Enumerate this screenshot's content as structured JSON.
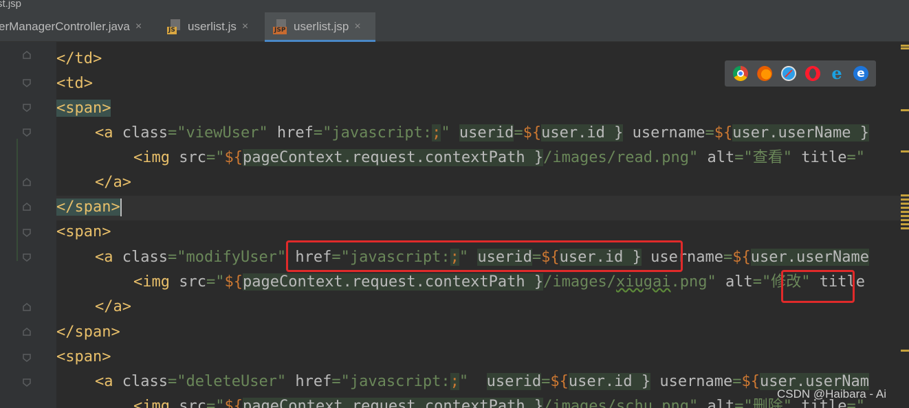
{
  "window": {
    "title_fragment": "st.jsp"
  },
  "tabs": [
    {
      "label": "erManagerController.java",
      "icon": "java-file-icon",
      "active": false
    },
    {
      "label": "userlist.js",
      "icon": "js-file-icon",
      "badge": "JS",
      "active": false
    },
    {
      "label": "userlist.jsp",
      "icon": "jsp-file-icon",
      "badge": "JSP",
      "active": true
    }
  ],
  "tab_close_glyph": "×",
  "code": {
    "l1": {
      "t1": "</td>"
    },
    "l2": {
      "t1": "<td>"
    },
    "l3": {
      "t1": "<",
      "t2": "span",
      "t3": ">"
    },
    "l4": {
      "t1": "<a ",
      "a1": "class",
      "e1": "=",
      "s1": "\"viewUser\"",
      "a2": " href",
      "e2": "=",
      "s2": "\"javascript:",
      "semi": ";",
      "s3": "\"",
      "sp": " ",
      "a3": "userid",
      "e3": "=",
      "v1": "${",
      "v2": "user.id }",
      "sp2": " ",
      "a4": "username",
      "e4": "=",
      "v3": "${",
      "v4": "user.userName }"
    },
    "l5": {
      "t1": "<img ",
      "a1": "src",
      "e1": "=",
      "s1": "\"",
      "v1": "${",
      "v2": "pageContext.request.contextPath }",
      "s2": "/images/read.png\"",
      "a2": " alt",
      "e2": "=",
      "s3": "\"查看\"",
      "a3": " title",
      "e3": "=",
      "s4": "\""
    },
    "l6": {
      "t1": "</a>"
    },
    "l7": {
      "t1": "</",
      "t2": "span",
      "t3": ">"
    },
    "l8": {
      "t1": "<span>"
    },
    "l9": {
      "t1": "<a ",
      "a1": "class",
      "e1": "=",
      "s1": "\"modifyUser\"",
      "a2": " href",
      "e2": "=",
      "s2": "\"javascript:",
      "semi": ";",
      "s3": "\"",
      "sp": " ",
      "a3": "userid",
      "e3": "=",
      "v1": "${",
      "v2": "user.id }",
      "sp2": " ",
      "a4": "username",
      "e4": "=",
      "v3": "${",
      "v4": "user.userName"
    },
    "l10": {
      "t1": "<img ",
      "a1": "src",
      "e1": "=",
      "s1": "\"",
      "v1": "${",
      "v2": "pageContext.request.contextPath }",
      "s2": "/images/",
      "s2b": "xiugai",
      "s2c": ".png\"",
      "a2": " alt",
      "e2": "=",
      "s3": "\"修改\"",
      "a3": " title"
    },
    "l11": {
      "t1": "</a>"
    },
    "l12": {
      "t1": "</span>"
    },
    "l13": {
      "t1": "<span>"
    },
    "l14": {
      "t1": "<a ",
      "a1": "class",
      "e1": "=",
      "s1": "\"deleteUser\"",
      "a2": " href",
      "e2": "=",
      "s2": "\"javascript:",
      "semi": ";",
      "s3": "\"",
      "sp": "  ",
      "a3": "userid",
      "e3": "=",
      "v1": "${",
      "v2": "user.id }",
      "sp2": " ",
      "a4": "username",
      "e4": "=",
      "v3": "${",
      "v4": "user.userNam"
    },
    "l15": {
      "t1": "<img ",
      "a1": "src",
      "e1": "=",
      "s1": "\"",
      "v1": "${",
      "v2": "pageContext.request.contextPath }",
      "s2": "/images/schu.png\"",
      "a2": " alt",
      "e2": "=",
      "s3": "\"删除\"",
      "a3": " title",
      "e3": "=",
      "s4": "\""
    }
  },
  "browser_icons": [
    "chrome-icon",
    "firefox-icon",
    "safari-icon",
    "opera-icon",
    "internet-explorer-icon",
    "edge-icon"
  ],
  "browser_glyphs": {
    "ie": "e",
    "edge": "e"
  },
  "watermark": "CSDN @Haibara - Ai",
  "colors": {
    "tag": "#e8bf6a",
    "attribute": "#bababa",
    "string": "#6a8759",
    "el": "#cc7832",
    "annotation_box": "#e02a2a"
  }
}
